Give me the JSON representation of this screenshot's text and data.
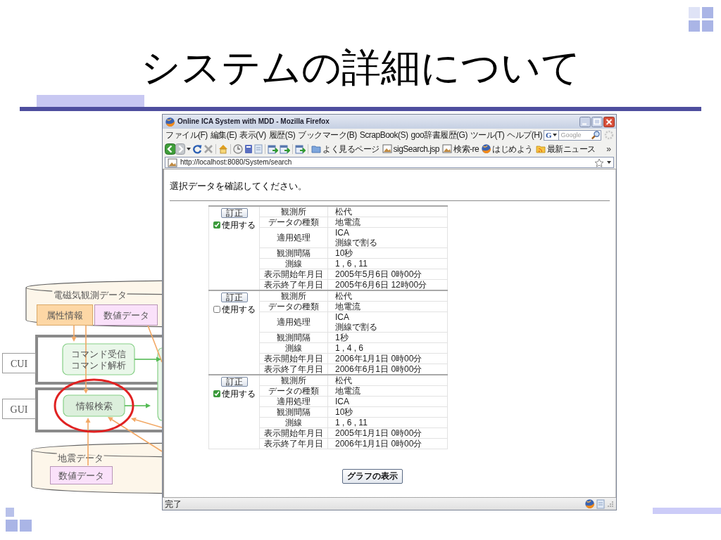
{
  "slide": {
    "title": "システムの詳細について"
  },
  "diagram": {
    "stores": [
      {
        "label": "電磁気観測データ",
        "parts": [
          {
            "label": "属性情報",
            "color": "#fdd7a5"
          },
          {
            "label": "数値データ",
            "color": "#fae1fa"
          }
        ]
      },
      {
        "label": "地震データ",
        "parts": [
          {
            "label": "数値データ",
            "color": "#fae1fa"
          }
        ]
      }
    ],
    "layers": [
      {
        "label": "CUI",
        "module_lines": [
          "コマンド受信",
          "コマンド解析"
        ],
        "highlighted": false
      },
      {
        "label": "GUI",
        "module_lines": [
          "情報検索"
        ],
        "highlighted": true
      }
    ]
  },
  "browser": {
    "title": "Online ICA System with MDD - Mozilla Firefox",
    "menu": [
      "ファイル(F)",
      "編集(E)",
      "表示(V)",
      "履歴(S)",
      "ブックマーク(B)",
      "ScrapBook(S)",
      "goo辞書履歴(G)",
      "ツール(T)",
      "ヘルプ(H)"
    ],
    "search": {
      "engine": "G",
      "placeholder": "Google"
    },
    "bookmarks": [
      {
        "label": "よく見るページ",
        "kind": "smart"
      },
      {
        "label": "sigSearch.jsp",
        "kind": "page"
      },
      {
        "label": "検索-re",
        "kind": "page"
      },
      {
        "label": "はじめよう",
        "kind": "firefox"
      },
      {
        "label": "最新ニュース",
        "kind": "feed"
      }
    ],
    "bookmarks_more": "»",
    "address": "http://localhost:8080/System/search",
    "page": {
      "heading": "選択データを確認してください。",
      "records": [
        {
          "action": "訂正",
          "use_label": "使用する",
          "checked": true,
          "fields": [
            {
              "label": "観測所",
              "value": "松代"
            },
            {
              "label": "データの種類",
              "value": "地電流"
            },
            {
              "label": "適用処理",
              "value": "ICA\n測線で割る"
            },
            {
              "label": "観測間隔",
              "value": "10秒"
            },
            {
              "label": "測線",
              "value": "1 , 6 , 11"
            },
            {
              "label": "表示開始年月日",
              "value": "2005年5月6日 0時00分"
            },
            {
              "label": "表示終了年月日",
              "value": "2005年6月6日 12時00分"
            }
          ]
        },
        {
          "action": "訂正",
          "use_label": "使用する",
          "checked": false,
          "fields": [
            {
              "label": "観測所",
              "value": "松代"
            },
            {
              "label": "データの種類",
              "value": "地電流"
            },
            {
              "label": "適用処理",
              "value": "ICA\n測線で割る"
            },
            {
              "label": "観測間隔",
              "value": "1秒"
            },
            {
              "label": "測線",
              "value": "1 , 4 , 6"
            },
            {
              "label": "表示開始年月日",
              "value": "2006年1月1日 0時00分"
            },
            {
              "label": "表示終了年月日",
              "value": "2006年6月1日 0時00分"
            }
          ]
        },
        {
          "action": "訂正",
          "use_label": "使用する",
          "checked": true,
          "fields": [
            {
              "label": "観測所",
              "value": "松代"
            },
            {
              "label": "データの種類",
              "value": "地電流"
            },
            {
              "label": "適用処理",
              "value": "ICA"
            },
            {
              "label": "観測間隔",
              "value": "10秒"
            },
            {
              "label": "測線",
              "value": "1 , 6 , 11"
            },
            {
              "label": "表示開始年月日",
              "value": "2005年1月1日 0時00分"
            },
            {
              "label": "表示終了年月日",
              "value": "2006年1月1日 0時00分"
            }
          ]
        }
      ],
      "submit": "グラフの表示"
    },
    "status": "完了"
  }
}
